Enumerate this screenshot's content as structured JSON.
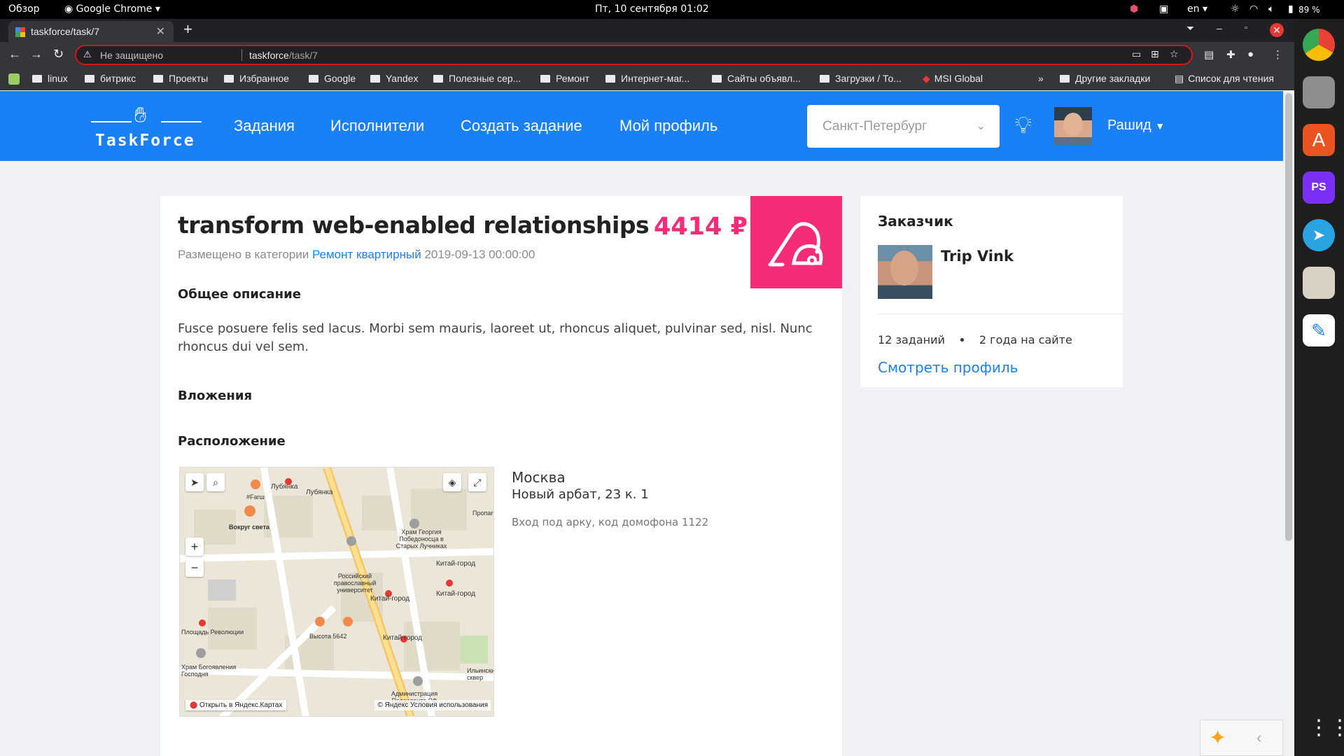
{
  "os": {
    "activities": "Обзор",
    "app_name": "Google Chrome",
    "datetime": "Пт, 10 сентября  01:02",
    "lang": "en",
    "battery": "89 %"
  },
  "browser": {
    "tab_title": "taskforce/task/7",
    "not_secure": "Не защищено",
    "url_host": "taskforce",
    "url_path": "/task/7",
    "bookmarks": [
      "linux",
      "битрикс",
      "Проекты",
      "Избранное",
      "Google",
      "Yandex",
      "Полезные сер...",
      "Ремонт",
      "Интернет-маг...",
      "Сайты объявл...",
      "Загрузки / То...",
      "MSI Global"
    ],
    "more": "»",
    "other_bookmarks": "Другие закладки",
    "reading_list": "Список для чтения"
  },
  "site": {
    "logo": "TaskForce",
    "nav": [
      "Задания",
      "Исполнители",
      "Создать задание",
      "Мой профиль"
    ],
    "city": "Санкт-Петербург",
    "user": "Рашид"
  },
  "task": {
    "title": "transform web-enabled relationships",
    "price": "4414 ₽",
    "meta_prefix": "Размещено в категории",
    "category": "Ремонт квартирный",
    "date": "2019-09-13 00:00:00",
    "desc_heading": "Общее описание",
    "description": "Fusce posuere felis sed lacus. Morbi sem mauris, laoreet ut, rhoncus aliquet, pulvinar sed, nisl. Nunc rhoncus dui vel sem.",
    "attachments_heading": "Вложения",
    "location_heading": "Расположение",
    "city": "Москва",
    "address": "Новый арбат, 23 к. 1",
    "note": "Вход под арку, код домофона 1122",
    "map_open": "Открыть в Яндекс.Картах",
    "map_copyright": "© Яндекс Условия использования",
    "map_labels": [
      "Лубянка",
      "Лубянка",
      "Вокруг света",
      "#Farш",
      "Храм Георгия Победоносца в Старых Лучниках",
      "Китай-город",
      "Китай-город",
      "Китай-город",
      "Китай-город",
      "Российский православный университет",
      "Высота 5642",
      "Площадь Революции",
      "Храм Богоявления Господня",
      "Администрация Президента РФ",
      "Ильинский сквер",
      "Пропаганда"
    ]
  },
  "customer": {
    "heading": "Заказчик",
    "name": "Trip Vink",
    "tasks": "12 заданий",
    "since": "2 года на сайте",
    "profile_link": "Смотреть профиль"
  }
}
